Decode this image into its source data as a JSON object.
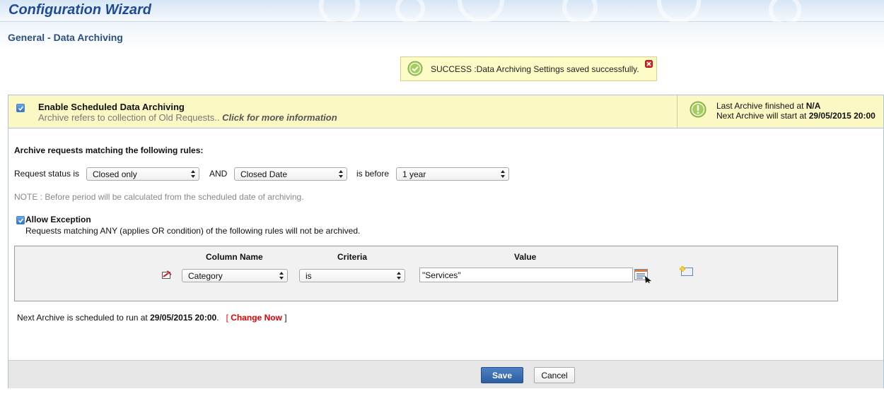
{
  "header": {
    "title": "Configuration Wizard",
    "subtitle": "General - Data Archiving"
  },
  "alert": {
    "message": "SUCCESS :Data Archiving Settings saved successfully.",
    "icon": "check-circle-icon",
    "close_icon": "close-icon"
  },
  "enable": {
    "checked": true,
    "title": "Enable Scheduled Data Archiving",
    "description": "Archive refers to collection of Old Requests..",
    "more_info_link": "Click for more information"
  },
  "archive_info": {
    "icon": "exclamation-circle-icon",
    "last_label": "Last Archive finished at ",
    "last_value": "N/A",
    "next_label": "Next Archive will start at ",
    "next_value": "29/05/2015 20:00"
  },
  "rules": {
    "heading": "Archive requests matching the following rules:",
    "status_label": "Request status is",
    "status_value": "Closed only",
    "and_label": "AND",
    "date_field_value": "Closed Date",
    "before_label": "is before",
    "period_value": "1 year",
    "note": "NOTE : Before period will be calculated from the scheduled date of archiving."
  },
  "exception": {
    "checked": true,
    "title": "Allow Exception",
    "description": "Requests matching ANY (applies OR condition) of the following rules will not be archived.",
    "columns": [
      "Column Name",
      "Criteria",
      "Value"
    ],
    "row": {
      "column": "Category",
      "criteria": "is",
      "value": "\"Services\""
    }
  },
  "schedule": {
    "prefix": "Next Archive is scheduled to run at ",
    "datetime": "29/05/2015 20:00",
    "suffix": ".",
    "open_bracket": "[",
    "change_link": "Change Now",
    "close_bracket": "]"
  },
  "footer": {
    "save_label": "Save",
    "cancel_label": "Cancel"
  },
  "colors": {
    "brand_title": "#1f4a99",
    "success_bg": "#fdfbc6",
    "enable_bg": "#fcf8c4",
    "link_red": "#e00000",
    "save_button": "#2c5ea3"
  }
}
